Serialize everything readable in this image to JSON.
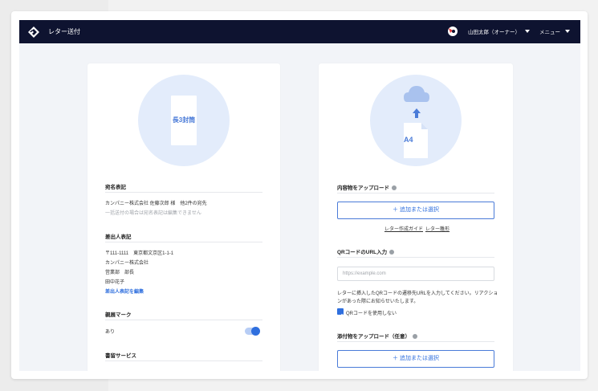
{
  "header": {
    "app_title": "レター送付",
    "user_name": "山田太郎（オーナー）",
    "menu_label": "メニュー"
  },
  "left_card": {
    "envelope_label": "長3封筒",
    "recipient": {
      "label": "宛名表記",
      "line1": "カンパニー株式会社 佐藤次郎 様　他2件の宛先",
      "note": "一括送付の場合は宛名表記は編集できません"
    },
    "sender": {
      "label": "差出人表記",
      "lines": [
        "〒111-1111　東京都文京区1-1-1",
        "カンパニー株式会社",
        "営業部　部長",
        "田中花子"
      ],
      "edit_link": "差出人表記を編集"
    },
    "seal": {
      "label": "親展マーク",
      "value": "あり",
      "enabled": true
    },
    "writing_service": {
      "label": "書留サービス"
    }
  },
  "right_card": {
    "paper_label": "A4",
    "upload_contents": {
      "label": "内容物をアップロード",
      "button_label": "＋ 追加または選択",
      "guide_link": "レター作成ガイド",
      "sample_link": "レター雛形"
    },
    "qr": {
      "label": "QRコードのURL入力",
      "placeholder": "https://example.com",
      "description_line1": "レターに挿入したQRコードの遷移先URLを入力してください。リアクショ",
      "description_line2": "ンがあった際にお知らせいたします。",
      "checkbox_label": "QRコードを使用しない",
      "checkbox_checked": true
    },
    "attachments": {
      "label": "添付物をアップロード（任意）",
      "button_label": "＋ 追加または選択"
    }
  },
  "colors": {
    "topbar": "#0e1330",
    "accent": "#2f6fde",
    "circle": "#e3ecfb"
  }
}
